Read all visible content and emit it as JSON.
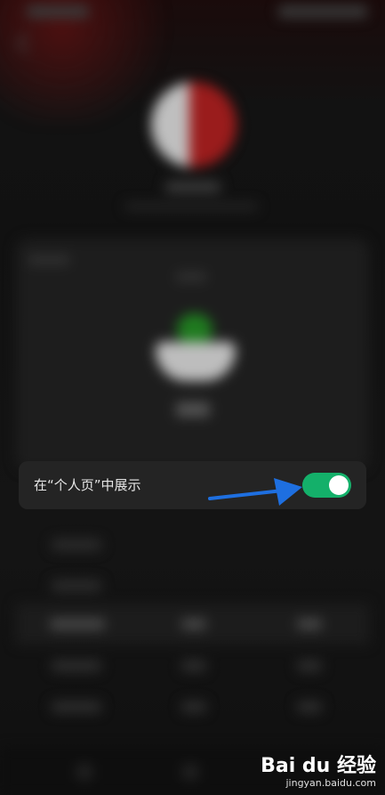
{
  "setting": {
    "label": "在“个人页”中展示",
    "toggle_on": true,
    "toggle_color": "#14b06a"
  },
  "annotation": {
    "arrow_color": "#1e6fe0"
  },
  "watermark": {
    "logo": "Bai du 经验",
    "url": "jingyan.baidu.com"
  }
}
